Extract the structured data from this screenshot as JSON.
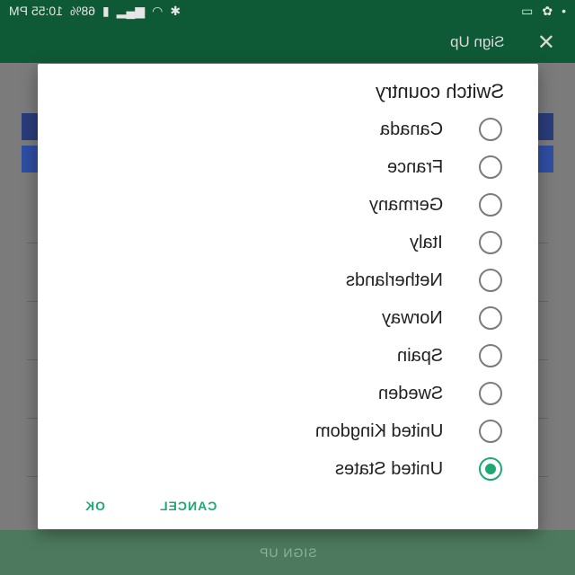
{
  "status_bar": {
    "time": "10:55 PM",
    "battery": "68%"
  },
  "app_bar": {
    "title": "Sign Up",
    "close_icon": "close-icon"
  },
  "dialog": {
    "title": "Switch country",
    "options": [
      {
        "label": "Canada",
        "selected": false
      },
      {
        "label": "France",
        "selected": false
      },
      {
        "label": "Germany",
        "selected": false
      },
      {
        "label": "Italy",
        "selected": false
      },
      {
        "label": "Netherlands",
        "selected": false
      },
      {
        "label": "Norway",
        "selected": false
      },
      {
        "label": "Spain",
        "selected": false
      },
      {
        "label": "Sweden",
        "selected": false
      },
      {
        "label": "United Kingdom",
        "selected": false
      },
      {
        "label": "United States",
        "selected": true
      }
    ],
    "cancel_label": "CANCEL",
    "ok_label": "OK"
  },
  "footer": {
    "signup_label": "SIGN UP"
  },
  "colors": {
    "accent": "#1fa972",
    "app_bar": "#0f5a36"
  }
}
